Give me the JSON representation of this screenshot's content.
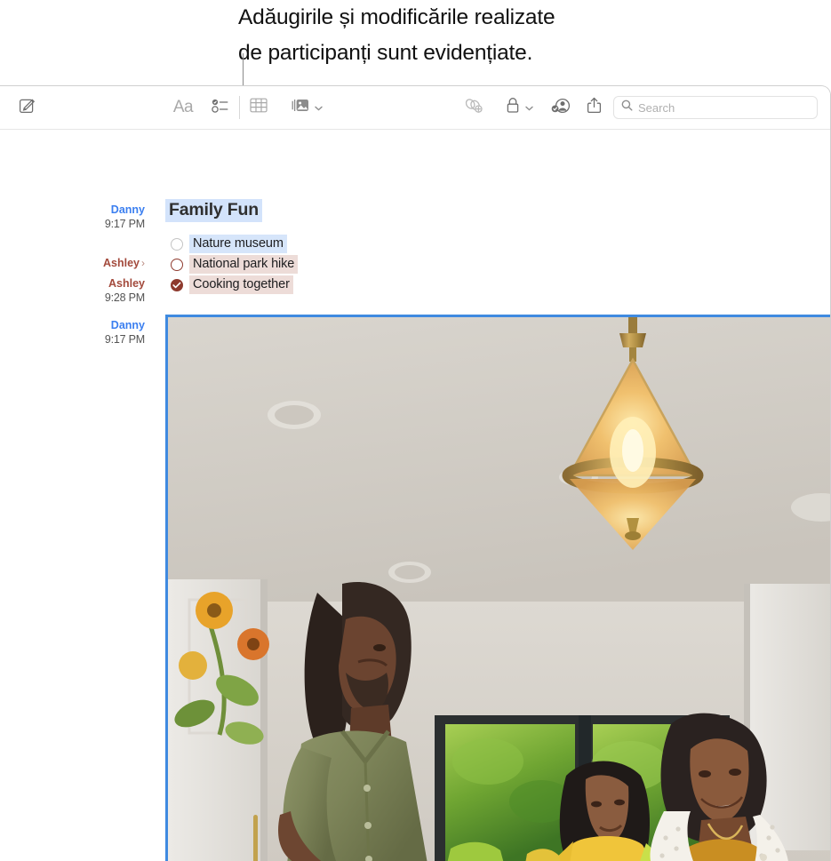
{
  "callout": {
    "text": "Adăugirile și modificările realizate\nde participanți sunt evidențiate."
  },
  "window": {
    "app": "Notes"
  },
  "toolbar": {
    "compose_label": "New Note",
    "format_label": "Aa",
    "checklist_label": "Checklist",
    "table_label": "Table",
    "media_label": "Media",
    "link_label": "Add Link",
    "lock_label": "Lock Note",
    "collaborate_label": "Collaborate",
    "share_label": "Share",
    "search": {
      "value": "",
      "placeholder": "Search"
    },
    "icons": {
      "compose": "compose-icon",
      "format": "format-text-icon",
      "checklist": "checklist-icon",
      "table": "table-icon",
      "media": "media-icon",
      "chevron": "chevron-down-icon",
      "link": "link-add-icon",
      "lock": "lock-icon",
      "collaborate": "collaborate-person-icon",
      "share": "share-icon",
      "search": "search-icon"
    }
  },
  "note": {
    "title": "Family Fun",
    "checklist": [
      {
        "label": "Nature museum",
        "checked": false,
        "highlight": "blue"
      },
      {
        "label": "National park hike",
        "checked": false,
        "highlight": "red"
      },
      {
        "label": "Cooking together",
        "checked": true,
        "highlight": "red"
      }
    ],
    "attributions": [
      {
        "author": "Danny",
        "time": "9:17 PM",
        "color_key": "danny",
        "chevron": false
      },
      {
        "author": "Ashley",
        "time": "",
        "color_key": "ashley",
        "chevron": true
      },
      {
        "author": "Ashley",
        "time": "9:28 PM",
        "color_key": "ashley",
        "chevron": false
      },
      {
        "author": "Danny",
        "time": "9:17 PM",
        "color_key": "danny",
        "chevron": false
      }
    ],
    "photo_alt": "Family cooking together in a kitchen"
  },
  "colors": {
    "danny": "#3b7ff0",
    "ashley": "#a34a3c",
    "highlight_blue": "#d6e5fa",
    "highlight_red": "#eddcd8",
    "title_highlight": "#d3e3fb",
    "selection_border": "#3f8ae0",
    "checkbox_checked": "#8e3a2e"
  }
}
